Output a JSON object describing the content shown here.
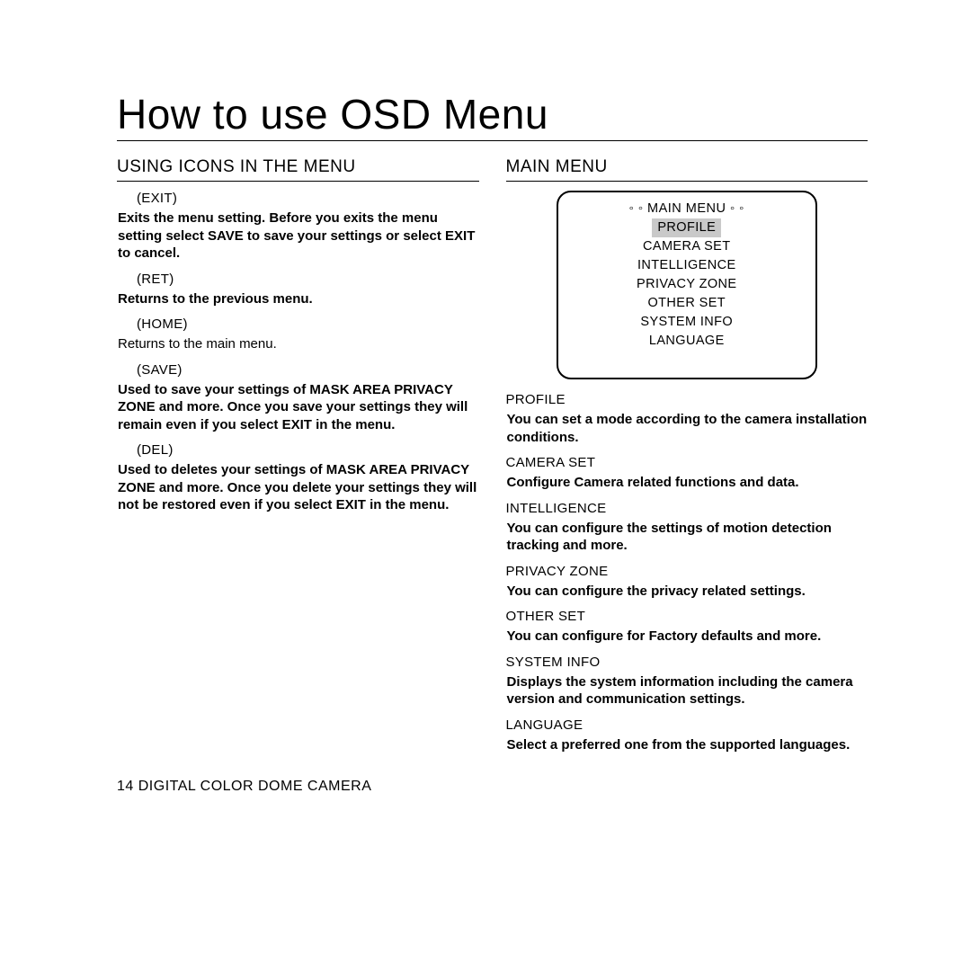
{
  "title": "How to use OSD Menu",
  "footer": "14  DIGITAL COLOR DOME CAMERA",
  "left": {
    "heading": "USING ICONS IN THE MENU",
    "items": [
      {
        "label": "(EXIT)",
        "bold": true,
        "desc": "Exits the menu setting.\nBefore you exits the menu setting select SAVE to save your settings or select EXIT to cancel."
      },
      {
        "label": "(RET)",
        "bold": true,
        "desc": "Returns to the previous menu."
      },
      {
        "label": "(HOME)",
        "bold": false,
        "desc": "Returns to the main menu."
      },
      {
        "label": "(SAVE)",
        "bold": true,
        "desc": "Used to save your settings of MASK AREA PRIVACY ZONE and more.\nOnce you save your settings they will remain even if you select EXIT in the menu."
      },
      {
        "label": "(DEL)",
        "bold": true,
        "desc": "Used to deletes your settings of MASK AREA PRIVACY ZONE and more.\nOnce you delete your settings they will not be restored even if you select EXIT in the menu."
      }
    ]
  },
  "right": {
    "heading": "MAIN MENU",
    "osd": {
      "title": "◦ ◦  MAIN MENU ◦ ◦",
      "selected": "PROFILE",
      "others": [
        "CAMERA SET",
        "INTELLIGENCE",
        "PRIVACY ZONE",
        "OTHER SET",
        "SYSTEM INFO",
        "LANGUAGE"
      ]
    },
    "items": [
      {
        "label": "PROFILE",
        "desc": "You can set a mode according to the camera installation conditions."
      },
      {
        "label": "CAMERA SET",
        "desc": "Configure Camera related functions and data."
      },
      {
        "label": "INTELLIGENCE",
        "desc": "You can configure the settings of motion detection tracking and more."
      },
      {
        "label": "PRIVACY ZONE",
        "desc": "You can configure the privacy related settings."
      },
      {
        "label": "OTHER SET",
        "desc": "You can configure for Factory defaults and more."
      },
      {
        "label": "SYSTEM INFO",
        "desc": "Displays the system information including the camera version and communication settings."
      },
      {
        "label": "LANGUAGE",
        "desc": "Select a preferred one from the supported languages."
      }
    ]
  }
}
